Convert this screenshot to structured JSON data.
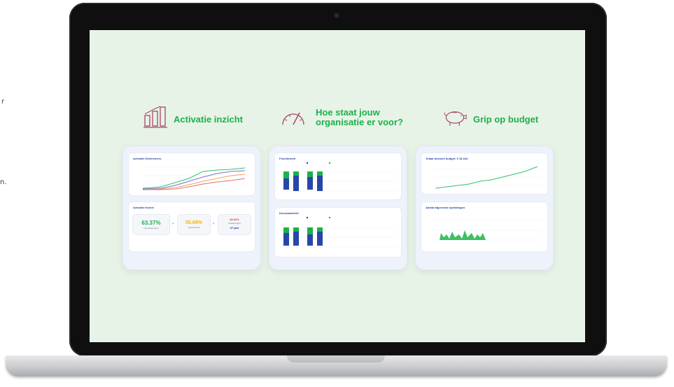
{
  "left_fragment": {
    "lines": [
      "r",
      "n."
    ]
  },
  "columns": [
    {
      "title": "Activatie inzicht",
      "icon": "bar-chart-icon",
      "panel1_title": "Activatie Deelnemers",
      "panel2_title": "Activatie funnel",
      "kpis": [
        {
          "value": "63.37%",
          "label": "van deelnemers",
          "color": "#1cb04c"
        },
        {
          "value": "55.68%",
          "label": "Geactiveerd",
          "color": "#f2b705"
        },
        {
          "value": "48.83%",
          "label": "Studiebudget",
          "color": "#e5483a"
        }
      ],
      "kpi_extra": "37 jaar"
    },
    {
      "title": "Hoe staat jouw organisatie er voor?",
      "title_lines": [
        "Hoe staat jouw",
        "organisatie er voor?"
      ],
      "icon": "speedometer-icon",
      "panel1_title": "Functiewerk",
      "panel2_title": "Duurzaamheid"
    },
    {
      "title": "Grip op budget",
      "icon": "piggy-bank-icon",
      "panel1_title": "Totaal besteed budget: € 18.344",
      "panel2_title": "Aantal afgeronde opleidingen"
    }
  ],
  "colors": {
    "accent_green": "#1cb04c",
    "navy": "#2746a8",
    "screen_bg": "#e7f3e6",
    "icon_pink": "#a8456a"
  }
}
